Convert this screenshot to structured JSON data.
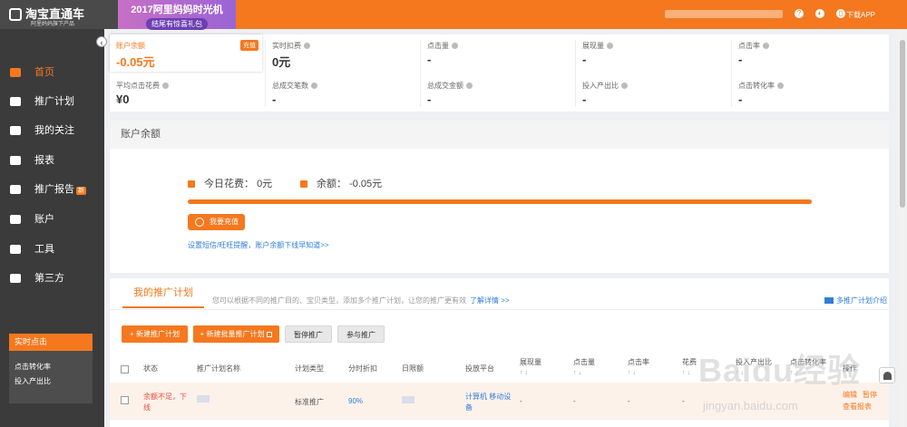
{
  "header": {
    "logo_text": "淘宝直通车",
    "logo_sub": "阿里妈妈旗下产品",
    "promo_title": "2017阿里妈妈时光机",
    "promo_sub": "结尾有惊喜礼包",
    "download_label": "下载APP"
  },
  "sidebar": {
    "items": [
      {
        "label": "首页",
        "icon": "home-icon"
      },
      {
        "label": "推广计划",
        "icon": "briefcase-icon"
      },
      {
        "label": "我的关注",
        "icon": "heart-icon"
      },
      {
        "label": "报表",
        "icon": "report-icon"
      },
      {
        "label": "推广报告",
        "icon": "report-bag-icon",
        "badge": "新"
      },
      {
        "label": "账户",
        "icon": "account-card-icon"
      },
      {
        "label": "工具",
        "icon": "toolbox-icon"
      },
      {
        "label": "第三方",
        "icon": "third-party-icon"
      }
    ],
    "realtime": {
      "title": "实时点击",
      "items": [
        "点击转化率",
        "投入产出比"
      ]
    }
  },
  "stats": [
    {
      "label": "账户余额",
      "value": "-0.05元",
      "action": "充值"
    },
    {
      "label": "实时扣费",
      "value": "0元"
    },
    {
      "label": "点击量",
      "value": "-"
    },
    {
      "label": "展现量",
      "value": "-"
    },
    {
      "label": "点击率",
      "value": "-"
    },
    {
      "label": "平均点击花费",
      "value": "¥0"
    },
    {
      "label": "总成交笔数",
      "value": "-"
    },
    {
      "label": "总成交金额",
      "value": "-"
    },
    {
      "label": "投入产出比",
      "value": "-"
    },
    {
      "label": "点击转化率",
      "value": "-"
    }
  ],
  "balance": {
    "title": "账户余额",
    "today_label": "今日花费：",
    "today_value": "0元",
    "remain_label": "余额：",
    "remain_value": "-0.05元",
    "recharge_button": "我要充值",
    "remind_link": "设置短信/旺旺提醒，账户余额下线早知道>>"
  },
  "plans": {
    "tab_label": "我的推广计划",
    "description": "您可以根据不同的推广目的、宝贝类型，添加多个推广计划，让您的推广更有效",
    "more_link": "了解详情 >>",
    "intro_link": "多推广计划介绍",
    "buttons": {
      "new_plan": "新建推广计划",
      "new_batch": "新建批量推广计划",
      "pause": "暂停推广",
      "join": "参与推广"
    },
    "columns": [
      "状态",
      "推广计划名称",
      "计划类型",
      "分时折扣",
      "日限额",
      "投放平台",
      "展现量",
      "点击量",
      "点击率",
      "花费",
      "投入产出比",
      "点击转化率",
      "操作"
    ],
    "rows": [
      {
        "status": "余额不足，下线",
        "type": "标准推广",
        "discount": "90%",
        "platform": "计算机 移动设备",
        "impressions": "-",
        "clicks": "-",
        "ctr": "-",
        "cost": "-",
        "actions": [
          "编辑",
          "暂停",
          "查看报表"
        ]
      }
    ]
  },
  "watermark": {
    "main": "Baidu经验",
    "sub": "jingyan.baidu.com"
  },
  "colors": {
    "accent": "#f5781e",
    "sidebar": "#3b3b3b",
    "link": "#2f7ed8"
  }
}
